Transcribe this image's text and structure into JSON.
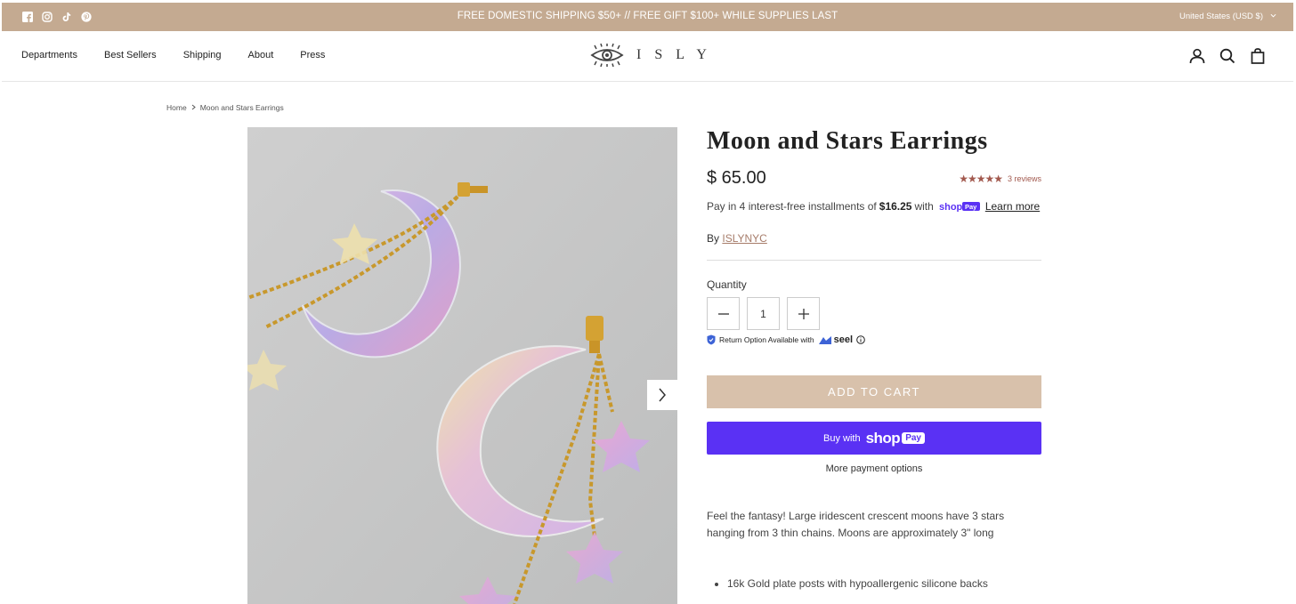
{
  "announcement": {
    "message": "FREE DOMESTIC SHIPPING $50+ // FREE GIFT $100+ WHILE SUPPLIES LAST",
    "region": "United States (USD $)",
    "social_icons": [
      "facebook-icon",
      "instagram-icon",
      "tiktok-icon",
      "pinterest-icon"
    ]
  },
  "nav": {
    "items": [
      "Departments",
      "Best Sellers",
      "Shipping",
      "About",
      "Press"
    ]
  },
  "logo": {
    "text": "ISLY"
  },
  "header_icons": [
    "account-icon",
    "search-icon",
    "cart-icon"
  ],
  "breadcrumb": {
    "home": "Home",
    "current": "Moon and Stars Earrings"
  },
  "product": {
    "title": "Moon and Stars Earrings",
    "price": "$ 65.00",
    "rating": {
      "stars": 5,
      "reviews": "3 reviews"
    },
    "installments": {
      "prefix": "Pay in 4 interest-free installments of",
      "amount": "$16.25",
      "with": "with",
      "learn_more": "Learn more"
    },
    "by_label": "By",
    "vendor": "ISLYNYC",
    "quantity_label": "Quantity",
    "quantity_value": "1",
    "seel_text": "Return Option Available with",
    "seel_brand": "seel",
    "add_to_cart": "ADD TO CART",
    "buy_with": "Buy with",
    "shop_label": "shop",
    "pay_label": "Pay",
    "more_payment": "More payment options",
    "description": "Feel the fantasy! Large iridescent crescent moons have 3 stars hanging from 3 thin chains.  Moons are approximately 3\" long",
    "features": [
      "16k Gold plate posts with hypoallergenic silicone backs"
    ]
  },
  "colors": {
    "announcement_bg": "#c4aa91",
    "add_to_cart_bg": "#d8c1ab",
    "shoppay_bg": "#5a31f4",
    "star_color": "#a2594e"
  }
}
